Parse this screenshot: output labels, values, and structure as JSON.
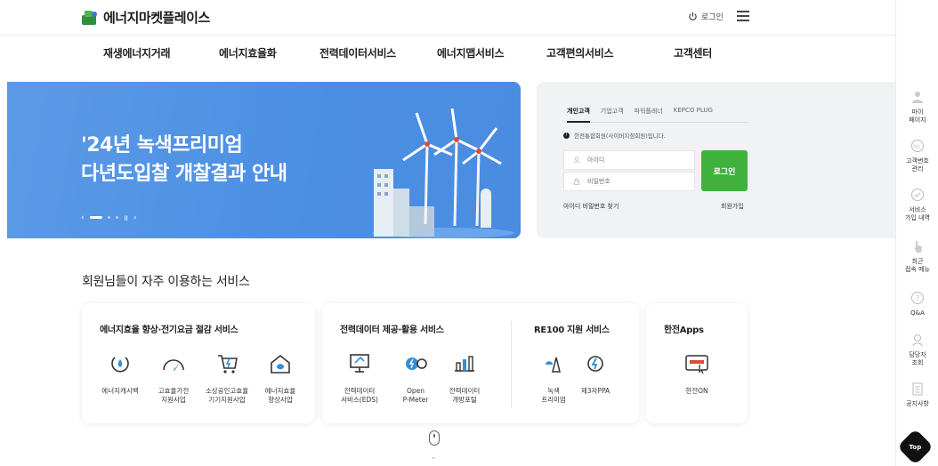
{
  "header": {
    "logo_text": "에너지마켓플레이스",
    "login_label": "로그인"
  },
  "gnb": [
    {
      "label": "재생에너지거래"
    },
    {
      "label": "에너지효율화"
    },
    {
      "label": "전력데이터서비스"
    },
    {
      "label": "에너지맵서비스"
    },
    {
      "label": "고객편의서비스"
    },
    {
      "label": "고객센터"
    }
  ],
  "banner": {
    "line1": "'24년 녹색프리미엄",
    "line2": "다년도입찰 개찰결과 안내",
    "prev": "‹",
    "pause": "॥",
    "next": "›"
  },
  "login": {
    "tabs": [
      "개인고객",
      "기업고객",
      "파워플래너",
      "KEPCO PLUG"
    ],
    "notice": "한전통합회원(사이버지점회원)입니다.",
    "id_placeholder": "아이디",
    "pw_placeholder": "비밀번호",
    "submit": "로그인",
    "find": "아이디 비밀번호 찾기",
    "join": "회원가입"
  },
  "services": {
    "title": "회원님들이 자주 이용하는 서비스",
    "card1": {
      "title": "에너지효율 향상·전기요금 절감 서비스",
      "items": [
        "에너지캐시백",
        "고효율가전\n지원사업",
        "소상공인고효율\n기기지원사업",
        "에너지효율\n향상사업"
      ]
    },
    "card2": {
      "title": "전력데이터 제공·활용 서비스",
      "items": [
        "전력데이터\n서비스(EDS)",
        "Open\nP-Meter",
        "전력데이터\n개방포털"
      ],
      "title_b": "RE100 지원 서비스",
      "items_b": [
        "녹색\n프리미엄",
        "제3자PPA"
      ]
    },
    "card3": {
      "title": "한전Apps",
      "items": [
        "한전ON"
      ]
    }
  },
  "quick": [
    {
      "label": "마이\n페이지",
      "icon": "user-icon"
    },
    {
      "label": "고객번호\n관리",
      "icon": "number-icon"
    },
    {
      "label": "서비스\n가입 내역",
      "icon": "check-circle-icon"
    },
    {
      "label": "최근\n접속 메뉴",
      "icon": "pointer-icon"
    },
    {
      "label": "Q&A",
      "icon": "question-icon"
    },
    {
      "label": "담당자\n조회",
      "icon": "person-search-icon"
    },
    {
      "label": "공지사항",
      "icon": "notice-icon"
    }
  ],
  "top_label": "Top",
  "colors": {
    "accent": "#3fb23d",
    "banner": "#4b8fe3"
  }
}
